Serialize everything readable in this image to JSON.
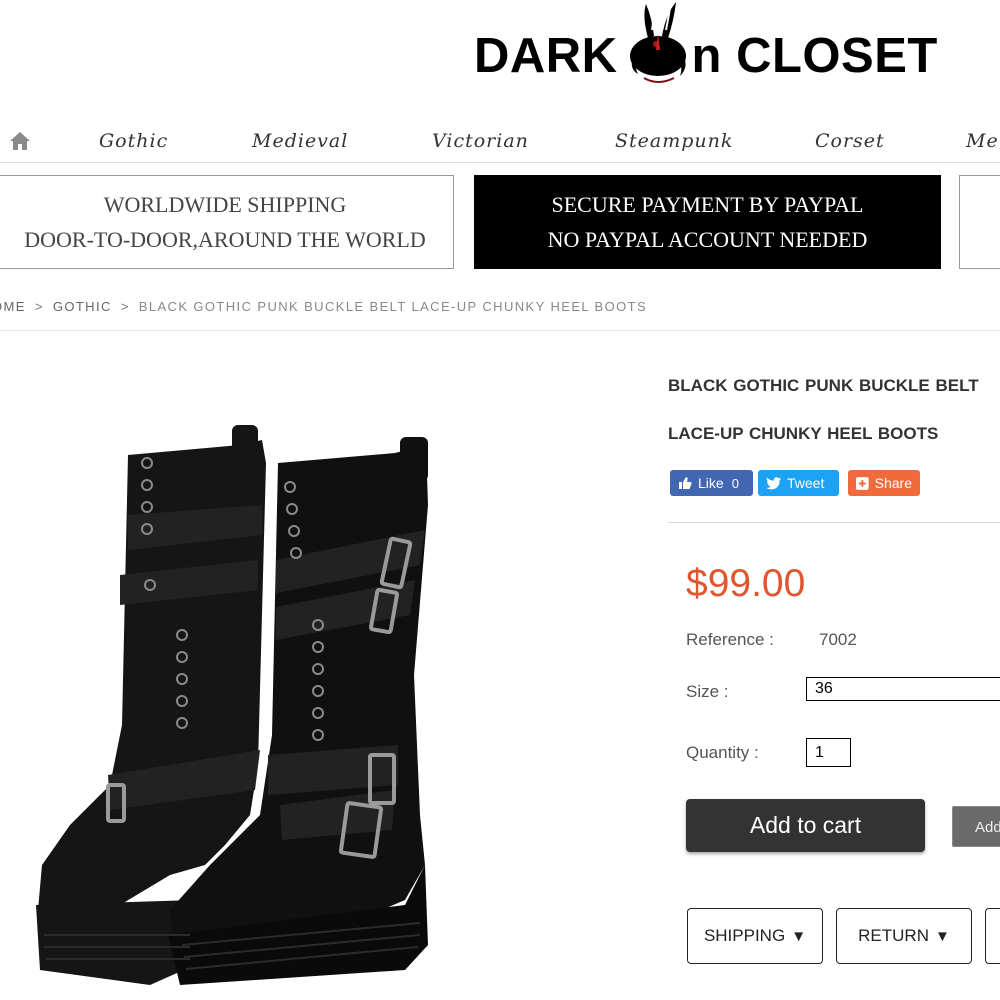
{
  "logo": {
    "word1": "DARK",
    "word2": "n CLOSET"
  },
  "nav": {
    "home_icon": "home-icon",
    "items": [
      {
        "label": "Gothic"
      },
      {
        "label": "Medieval"
      },
      {
        "label": "Victorian"
      },
      {
        "label": "Steampunk"
      },
      {
        "label": "Corset"
      },
      {
        "label": "Men"
      }
    ]
  },
  "banners": {
    "shipping": {
      "line1": "WORLDWIDE SHIPPING",
      "line2": "DOOR-TO-DOOR,AROUND THE WORLD"
    },
    "payment": {
      "line1": "SECURE PAYMENT BY PAYPAL",
      "line2": "NO PAYPAL ACCOUNT NEEDED"
    }
  },
  "breadcrumb": {
    "home": "OME",
    "separator": ">",
    "category": "GOTHIC",
    "current": "BLACK GOTHIC PUNK BUCKLE BELT LACE-UP CHUNKY HEEL BOOTS"
  },
  "product": {
    "title": "BLACK GOTHIC PUNK BUCKLE BELT LACE-UP CHUNKY HEEL BOOTS",
    "image_alt": "Black gothic punk buckle belt lace-up chunky heel boots",
    "price": "$99.00",
    "reference_label": "Reference :",
    "reference_value": "7002",
    "size_label": "Size :",
    "size_value": "36",
    "quantity_label": "Quantity :",
    "quantity_value": "1",
    "add_to_cart": "Add to cart",
    "add_to_wishlist": "Add to wishlist"
  },
  "social": {
    "like_label": "Like",
    "like_count": "0",
    "tweet_label": "Tweet",
    "share_label": "Share"
  },
  "tabs": {
    "shipping": "SHIPPING",
    "return": "RETURN",
    "arrow": "▼"
  },
  "colors": {
    "price": "#e2562f",
    "facebook": "#4267b2",
    "twitter": "#1da1f2",
    "share": "#f06a3c",
    "cart_button": "#333333",
    "banner_dark": "#000000"
  }
}
